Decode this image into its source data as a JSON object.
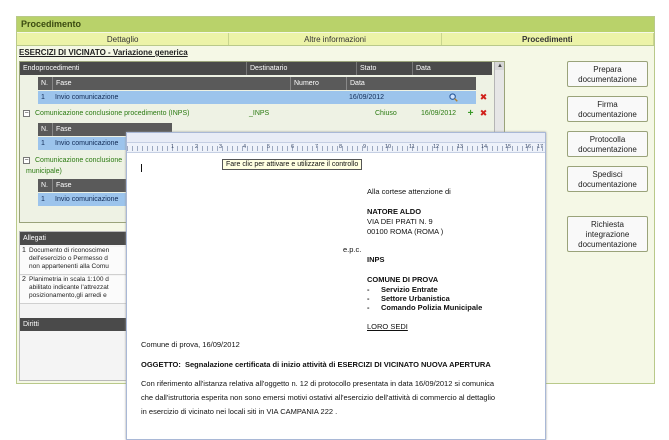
{
  "panel": {
    "title": "Procedimento",
    "tabs": [
      {
        "label": "Dettaglio"
      },
      {
        "label": "Altre informazioni"
      },
      {
        "label": "Procedimenti"
      }
    ],
    "subtitle": "ESERCIZI DI VICINATO - Variazione generica"
  },
  "grid": {
    "headers": {
      "endoprocedimenti": "Endoprocedimenti",
      "destinatario": "Destinatario",
      "stato": "Stato",
      "data": "Data"
    },
    "sub_headers": {
      "n": "N.",
      "fase": "Fase",
      "numero": "Numero",
      "data": "Data"
    },
    "rows": [
      {
        "n": "1",
        "fase": "Invio comunicazione",
        "data": "16/09/2012"
      }
    ],
    "endo2": {
      "label": "Comunicazione conclusione procedimento (INPS)",
      "destinatario": "_INPS",
      "stato": "Chiuso",
      "data": "16/09/2012"
    },
    "endo2_rows": [
      {
        "n": "1",
        "fase": "Invio comunicazione"
      }
    ],
    "endo3": {
      "label_line1": "Comunicazione conclusione",
      "label_line2": "municipale)"
    },
    "endo3_rows": [
      {
        "n": "1",
        "fase": "Invio comunicazione"
      }
    ]
  },
  "lower": {
    "allegati_header": "Allegati",
    "allegati": [
      {
        "n": "1",
        "line1": "Documento di riconoscimen",
        "line2": "dell'esercizio o Permesso d",
        "line3": "non appartenenti alla Comu"
      },
      {
        "n": "2",
        "line1": "Planimetria in scala 1:100 d",
        "line2": "abilitato indicante l'attrezzat",
        "line3": "posizionamento,gli arredi e"
      }
    ],
    "diritti_header": "Diritti"
  },
  "side_buttons": [
    {
      "label_1": "Prepara",
      "label_2": "documentazione"
    },
    {
      "label_1": "Firma",
      "label_2": "documentazione"
    },
    {
      "label_1": "Protocolla",
      "label_2": "documentazione"
    },
    {
      "label_1": "Spedisci",
      "label_2": "documentazione"
    },
    {
      "label_1": "Richiesta",
      "label_2": "integrazione",
      "label_3": "documentazione"
    }
  ],
  "tooltip": "Fare clic per attivare e utilizzare il controllo",
  "ruler": {
    "numbers": [
      "1",
      "2",
      "3",
      "4",
      "5",
      "6",
      "7",
      "8",
      "9",
      "10",
      "11",
      "12",
      "13",
      "14",
      "15",
      "16",
      "17"
    ]
  },
  "document": {
    "attention": "Alla cortese attenzione di",
    "recipient_name": "NATORE ALDO",
    "recipient_addr1": "VIA DEI PRATI  N. 9",
    "recipient_addr2": "00100 ROMA (ROMA )",
    "epc": "e.p.c.",
    "inps": "INPS",
    "comune": "COMUNE DI PROVA",
    "servizi": [
      {
        "dash": "-",
        "label": "Servizio Entrate"
      },
      {
        "dash": "-",
        "label": "Settore Urbanistica"
      },
      {
        "dash": "-",
        "label": "Comando Polizia  Municipale"
      }
    ],
    "loro_sedi": "LORO SEDI",
    "place_date": "Comune di prova, 16/09/2012",
    "oggetto_label": "OGGETTO:",
    "oggetto_text": "Segnalazione certificata di inizio attività di ESERCIZI DI VICINATO  NUOVA APERTURA",
    "body_line1": "Con riferimento all'istanza relativa all'oggetto n. 12  di protocollo presentata in data 16/09/2012  si comunica",
    "body_line2": "che dall'istruttoria esperita non sono emersi motivi ostativi all'esercizio dell'attività di commercio al dettaglio",
    "body_line3": "in esercizio di vicinato nei locali siti in VIA CAMPANIA 222  ."
  }
}
